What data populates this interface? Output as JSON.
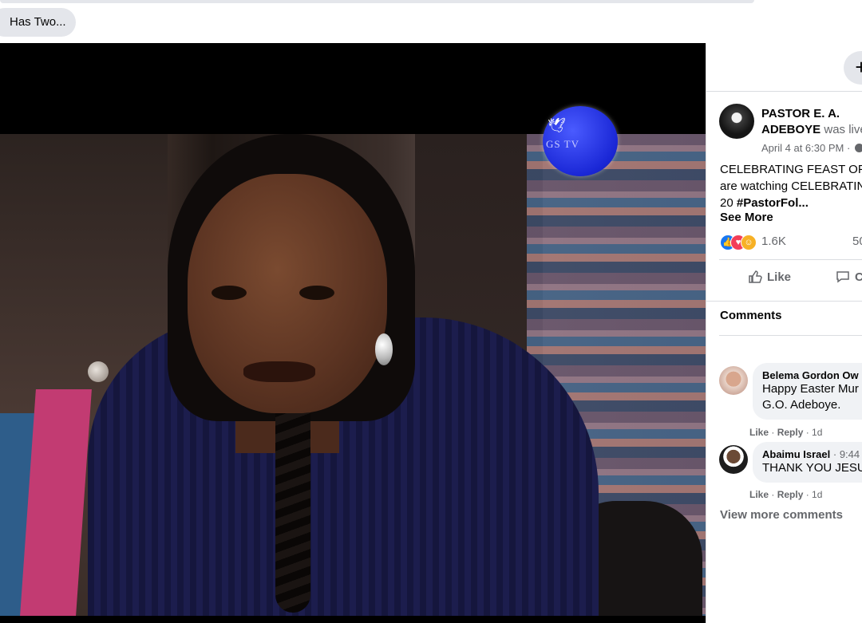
{
  "top": {
    "chip_label": "Has Two..."
  },
  "video": {
    "channel_logo_text": "GS TV"
  },
  "panel": {
    "add_button_label": "+",
    "post": {
      "author": "PASTOR E. A. ADEBOYE",
      "status": "was live",
      "timestamp": "April 4 at 6:30 PM ·",
      "text_line1": "CELEBRATING FEAST OF E",
      "text_line2": "are watching CELEBRATIN",
      "text_line3_prefix": "20 ",
      "text_line3_hashtag": "#PastorFol...",
      "see_more": "See More",
      "reaction_count": "1.6K",
      "share_count": "50"
    },
    "actions": {
      "like": "Like",
      "comment": "C"
    },
    "comments_heading": "Comments",
    "comments": [
      {
        "name": "Belema Gordon Ow",
        "time": "",
        "line1": "Happy Easter Mur",
        "line2": "G.O. Adeboye.",
        "like": "Like",
        "reply": "Reply",
        "age": "1d"
      },
      {
        "name": "Abaimu Israel",
        "time": "· 9:44",
        "line1": "THANK YOU JESU",
        "like": "Like",
        "reply": "Reply",
        "age": "1d"
      }
    ],
    "view_more": "View more comments"
  }
}
